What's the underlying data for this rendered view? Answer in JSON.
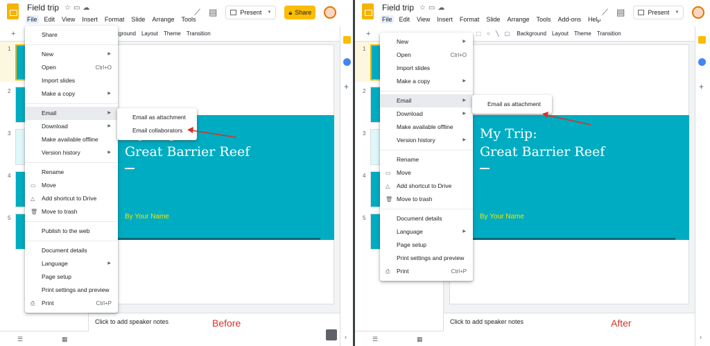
{
  "doc_title": "Field trip",
  "menubar": [
    "File",
    "Edit",
    "View",
    "Insert",
    "Format",
    "Slide",
    "Arrange",
    "Tools",
    "Add-ons",
    "Help"
  ],
  "present_label": "Present",
  "share_label": "Share",
  "toolbar": {
    "background": "Background",
    "layout": "Layout",
    "theme": "Theme",
    "transition": "Transition"
  },
  "slide": {
    "title_line1": "My Trip:",
    "title_line2": "Great Barrier Reef",
    "subtitle": "By Your Name"
  },
  "speaker_notes": "Click to add speaker notes",
  "thumb_numbers": [
    "1",
    "2",
    "3",
    "4",
    "5"
  ],
  "left": {
    "caption": "Before",
    "menu": [
      {
        "label": "Share"
      },
      {
        "sep": true
      },
      {
        "label": "New",
        "arrow": true
      },
      {
        "label": "Open",
        "shortcut": "Ctrl+O"
      },
      {
        "label": "Import slides"
      },
      {
        "label": "Make a copy",
        "arrow": true
      },
      {
        "sep": true
      },
      {
        "label": "Email",
        "arrow": true,
        "highlight": true
      },
      {
        "label": "Download",
        "arrow": true
      },
      {
        "label": "Make available offline"
      },
      {
        "label": "Version history",
        "arrow": true
      },
      {
        "sep": true
      },
      {
        "label": "Rename"
      },
      {
        "label": "Move",
        "icon": "folder-icon"
      },
      {
        "label": "Add shortcut to Drive",
        "icon": "drive-icon"
      },
      {
        "label": "Move to trash",
        "icon": "trash-icon"
      },
      {
        "sep": true
      },
      {
        "label": "Publish to the web"
      },
      {
        "sep": true
      },
      {
        "label": "Document details"
      },
      {
        "label": "Language",
        "arrow": true
      },
      {
        "label": "Page setup"
      },
      {
        "label": "Print settings and preview"
      },
      {
        "label": "Print",
        "shortcut": "Ctrl+P",
        "icon": "print-icon"
      }
    ],
    "submenu": [
      "Email as attachment",
      "Email collaborators"
    ]
  },
  "right": {
    "caption": "After",
    "menu": [
      {
        "label": "New",
        "arrow": true
      },
      {
        "label": "Open",
        "shortcut": "Ctrl+O"
      },
      {
        "label": "Import slides"
      },
      {
        "label": "Make a copy",
        "arrow": true
      },
      {
        "sep": true
      },
      {
        "label": "Email",
        "arrow": true,
        "highlight": true
      },
      {
        "label": "Download",
        "arrow": true
      },
      {
        "label": "Make available offline"
      },
      {
        "label": "Version history",
        "arrow": true
      },
      {
        "sep": true
      },
      {
        "label": "Rename"
      },
      {
        "label": "Move",
        "icon": "folder-icon"
      },
      {
        "label": "Add shortcut to Drive",
        "icon": "drive-icon"
      },
      {
        "label": "Move to trash",
        "icon": "trash-icon"
      },
      {
        "sep": true
      },
      {
        "label": "Document details"
      },
      {
        "label": "Language",
        "arrow": true
      },
      {
        "label": "Page setup"
      },
      {
        "label": "Print settings and preview"
      },
      {
        "label": "Print",
        "shortcut": "Ctrl+P",
        "icon": "print-icon"
      }
    ],
    "submenu": [
      "Email as attachment"
    ]
  },
  "colors": {
    "accent": "#00acc1",
    "share": "#fbbc04",
    "annotation": "#d93025",
    "subtitle": "#f2e600"
  }
}
